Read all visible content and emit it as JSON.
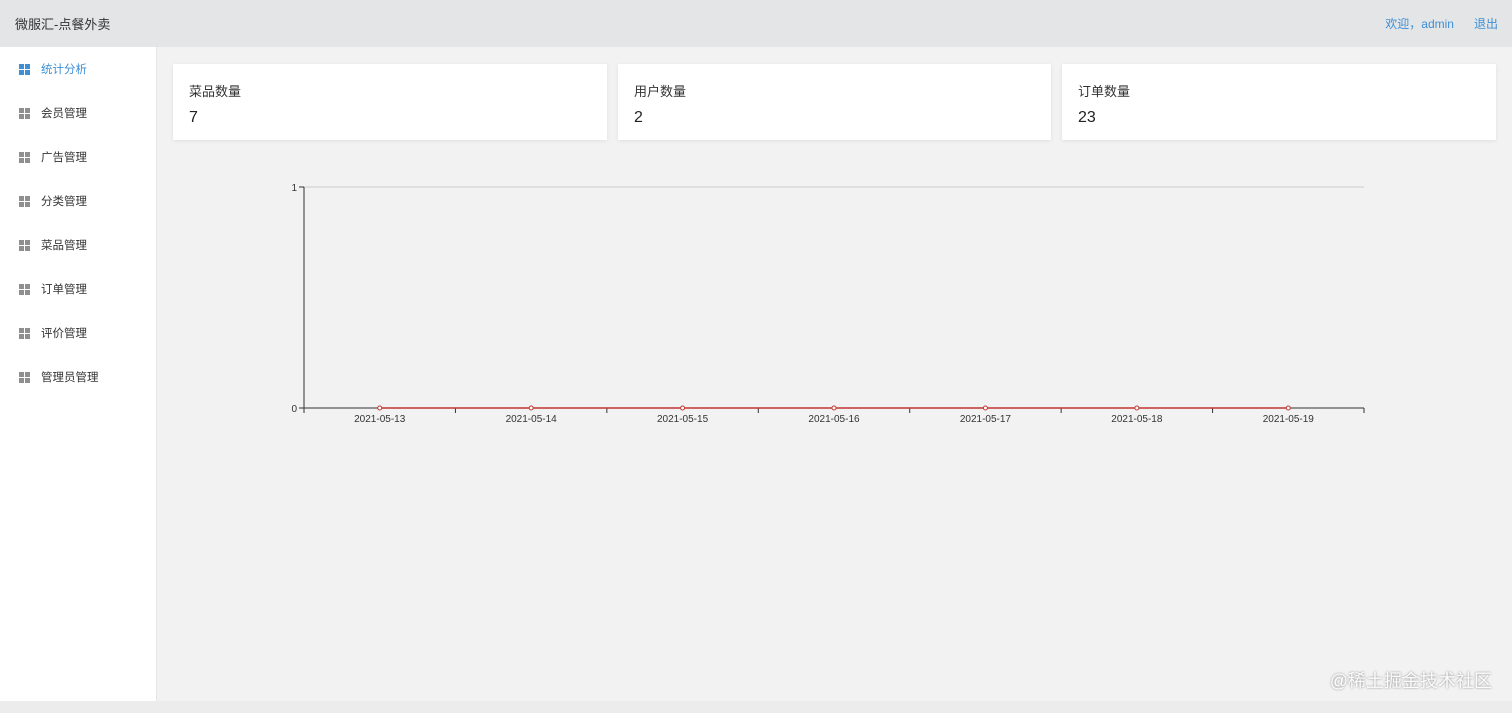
{
  "header": {
    "app_title": "微服汇-点餐外卖",
    "welcome": "欢迎，admin",
    "logout": "退出"
  },
  "sidebar": {
    "items": [
      {
        "label": "统计分析",
        "active": true
      },
      {
        "label": "会员管理",
        "active": false
      },
      {
        "label": "广告管理",
        "active": false
      },
      {
        "label": "分类管理",
        "active": false
      },
      {
        "label": "菜品管理",
        "active": false
      },
      {
        "label": "订单管理",
        "active": false
      },
      {
        "label": "评价管理",
        "active": false
      },
      {
        "label": "管理员管理",
        "active": false
      }
    ]
  },
  "stats": [
    {
      "label": "菜品数量",
      "value": "7"
    },
    {
      "label": "用户数量",
      "value": "2"
    },
    {
      "label": "订单数量",
      "value": "23"
    }
  ],
  "chart_data": {
    "type": "line",
    "title": "",
    "xlabel": "",
    "ylabel": "",
    "x": [
      "2021-05-13",
      "2021-05-14",
      "2021-05-15",
      "2021-05-16",
      "2021-05-17",
      "2021-05-18",
      "2021-05-19"
    ],
    "series": [
      {
        "values": [
          0,
          0,
          0,
          0,
          0,
          0,
          0
        ],
        "color": "#c23531"
      }
    ],
    "ylim": [
      0,
      1
    ],
    "yticks": [
      "0",
      "1"
    ],
    "grid": true,
    "legend": "none"
  },
  "watermark": "@稀土掘金技术社区",
  "colors": {
    "accent": "#3d8fd6",
    "line": "#c23531",
    "header_bg": "#e4e5e7",
    "content_bg": "#f2f2f2"
  }
}
